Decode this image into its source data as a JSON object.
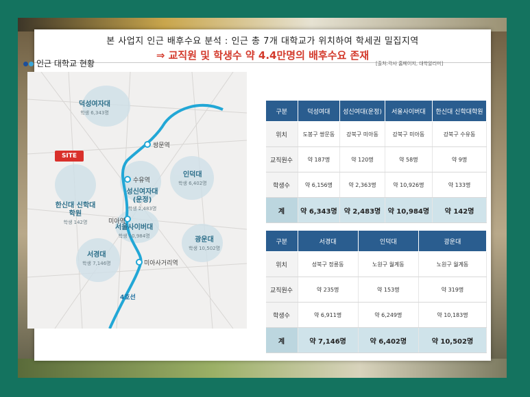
{
  "header": {
    "line1": "본 사업지 인근 배후수요 분석 : 인근 총 7개 대학교가 위치하여 학세권 밀집지역",
    "line2": "⇒ 교직원 및 학생수 약 4.4만명의 배후수요 존재"
  },
  "section_title": "인근 대학교 현황",
  "source": "[출처:각사 홈페이지, 대학알리미]",
  "map": {
    "site_label": "SITE",
    "line_label": "4호선",
    "stations": [
      "쌍문역",
      "수유역",
      "미아역",
      "미아사거리역"
    ],
    "universities": [
      {
        "name": "덕성여자대",
        "sub": "학생 6,343명"
      },
      {
        "name": "성신여자대(운정)",
        "sub": "학생 2,483명"
      },
      {
        "name": "한신대 신학대학원",
        "sub": "학생 142명"
      },
      {
        "name": "서울사이버대",
        "sub": "학생 10,984명"
      },
      {
        "name": "서경대",
        "sub": "학생 7,146명"
      },
      {
        "name": "인덕대",
        "sub": "학생 6,402명"
      },
      {
        "name": "광운대",
        "sub": "학생 10,502명"
      }
    ]
  },
  "table1": {
    "headers": [
      "구분",
      "덕성여대",
      "성신여대(운정)",
      "서울사이버대",
      "한신대 신학대학원"
    ],
    "rows": [
      {
        "label": "위치",
        "cells": [
          "도봉구 쌍문동",
          "강북구 미아동",
          "강북구 미아동",
          "강북구 수유동"
        ]
      },
      {
        "label": "교직원수",
        "cells": [
          "약 187명",
          "약 120명",
          "약 58명",
          "약 9명"
        ]
      },
      {
        "label": "학생수",
        "cells": [
          "약 6,156명",
          "약 2,363명",
          "약 10,926명",
          "약 133명"
        ]
      },
      {
        "label": "계",
        "cells": [
          "약 6,343명",
          "약 2,483명",
          "약 10,984명",
          "약 142명"
        ]
      }
    ]
  },
  "table2": {
    "headers": [
      "구분",
      "서경대",
      "인덕대",
      "광운대"
    ],
    "rows": [
      {
        "label": "위치",
        "cells": [
          "성북구 정릉동",
          "노원구 월계동",
          "노원구 월계동"
        ]
      },
      {
        "label": "교직원수",
        "cells": [
          "약 235명",
          "약 153명",
          "약 319명"
        ]
      },
      {
        "label": "학생수",
        "cells": [
          "약 6,911명",
          "약 6,249명",
          "약 10,183명"
        ]
      },
      {
        "label": "계",
        "cells": [
          "약 7,146명",
          "약 6,402명",
          "약 10,502명"
        ]
      }
    ]
  },
  "colors": {
    "frame": "#14735f",
    "header_accent": "#d33a2c",
    "table_header": "#2a5d8f",
    "total_row": "#cfe3ea",
    "subway_line": "#22a7d6"
  }
}
